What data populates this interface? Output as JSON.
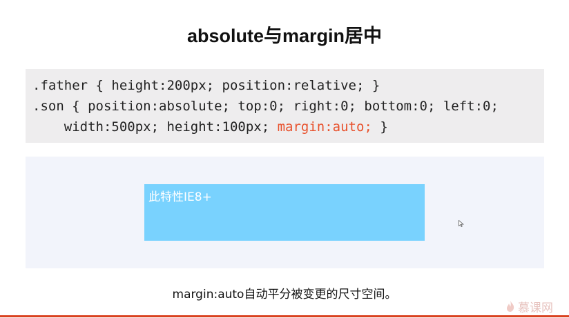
{
  "slide": {
    "title": "absolute与margin居中",
    "code": {
      "line1": ".father { height:200px; position:relative; }",
      "line2": ".son { position:absolute; top:0; right:0; bottom:0; left:0;",
      "line3_plain": "    width:500px; height:100px; ",
      "line3_highlight": "margin:auto;",
      "line3_end": " }"
    },
    "demo_label": "此特性IE8+",
    "caption": "margin:auto自动平分被变更的尺寸空间。",
    "watermark": "慕课网",
    "colors": {
      "highlight": "#e8512c",
      "son_box": "#79d2fe",
      "bottom_rule": "#d9411f"
    }
  }
}
